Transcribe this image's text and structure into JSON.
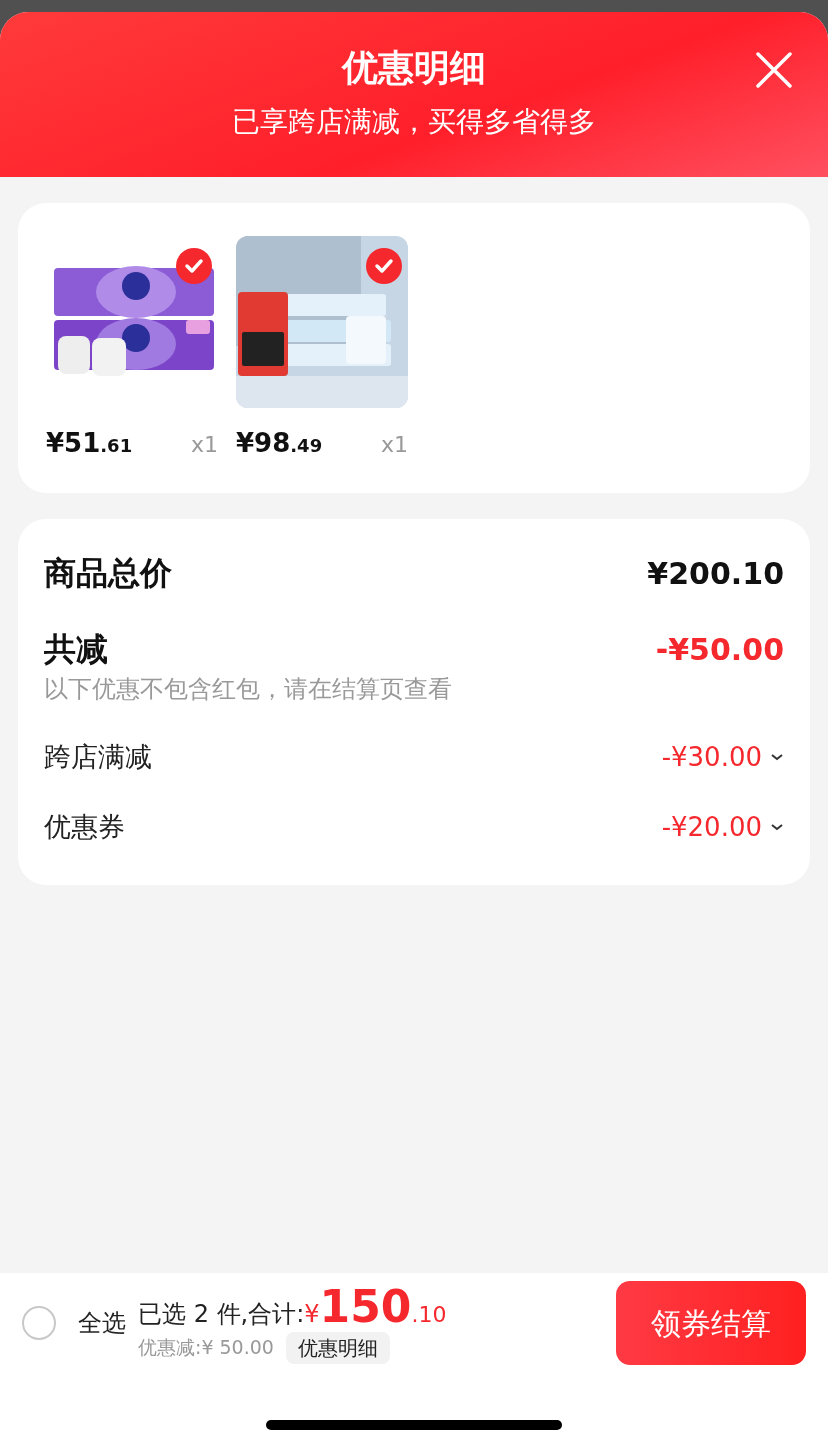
{
  "header": {
    "title": "优惠明细",
    "subtitle": "已享跨店满减，买得多省得多"
  },
  "products": [
    {
      "kind": "picture",
      "selected": true,
      "price_main": "¥51",
      "price_cents": ".61",
      "quantity": "x1"
    },
    {
      "kind": "picture",
      "selected": true,
      "price_main": "¥98",
      "price_cents": ".49",
      "quantity": "x1"
    }
  ],
  "summary": {
    "total_label": "商品总价",
    "total_amount": "¥200.10",
    "reduction_label": "共减",
    "reduction_amount": "-¥50.00",
    "reduction_note": "以下优惠不包含红包，请在结算页查看",
    "discounts": [
      {
        "label": "跨店满减",
        "amount": "-¥30.00",
        "expanded": false
      },
      {
        "label": "优惠券",
        "amount": "-¥20.00",
        "expanded": false
      }
    ]
  },
  "footer": {
    "select_all": {
      "label": "全选",
      "checked": false
    },
    "selected_text": "已选 2 件,合计:",
    "currency": "¥",
    "total_main": "150",
    "total_cents": ".10",
    "discount_text": "优惠减:¥ 50.00",
    "detail_link": "优惠明细",
    "checkout_button": "领券结算"
  }
}
